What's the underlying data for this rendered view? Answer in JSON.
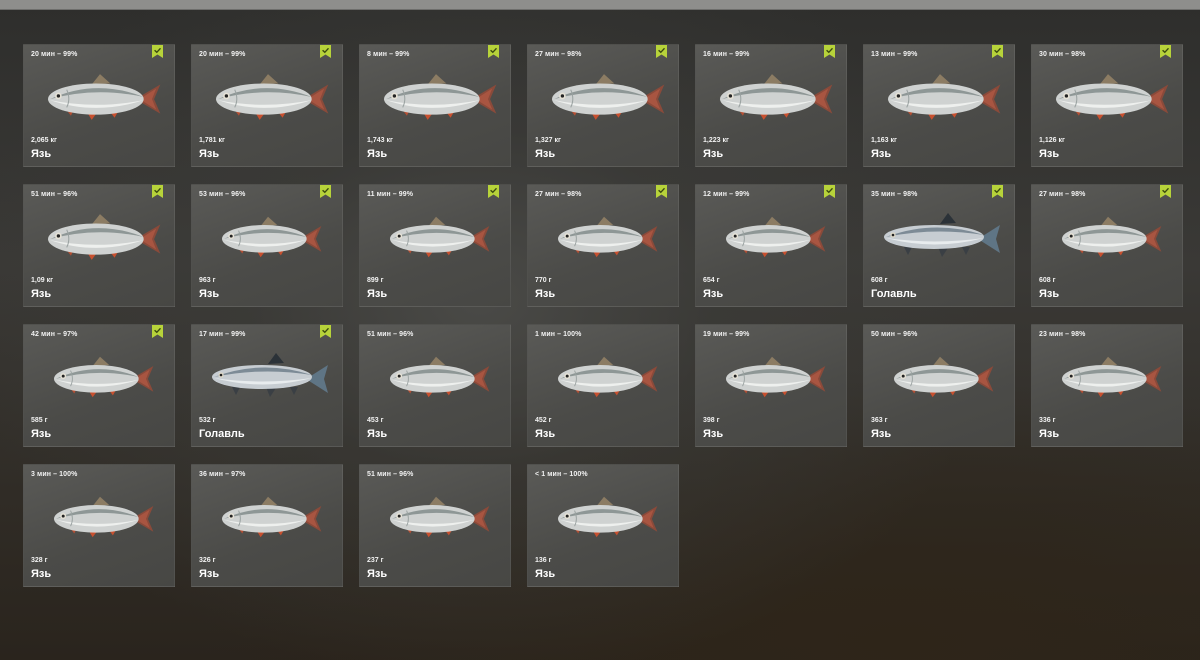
{
  "catches": [
    {
      "meta": "20 мин – 99%",
      "weight": "2,065 кг",
      "species": "Язь",
      "kept": true,
      "fish_icon": "ide-icon"
    },
    {
      "meta": "20 мин – 99%",
      "weight": "1,781 кг",
      "species": "Язь",
      "kept": true,
      "fish_icon": "ide-icon"
    },
    {
      "meta": "8 мин – 99%",
      "weight": "1,743 кг",
      "species": "Язь",
      "kept": true,
      "fish_icon": "ide-icon"
    },
    {
      "meta": "27 мин – 98%",
      "weight": "1,327 кг",
      "species": "Язь",
      "kept": true,
      "fish_icon": "ide-icon"
    },
    {
      "meta": "16 мин – 99%",
      "weight": "1,223 кг",
      "species": "Язь",
      "kept": true,
      "fish_icon": "ide-icon"
    },
    {
      "meta": "13 мин – 99%",
      "weight": "1,163 кг",
      "species": "Язь",
      "kept": true,
      "fish_icon": "ide-icon"
    },
    {
      "meta": "30 мин – 98%",
      "weight": "1,126 кг",
      "species": "Язь",
      "kept": true,
      "fish_icon": "ide-icon"
    },
    {
      "meta": "51 мин – 96%",
      "weight": "1,09 кг",
      "species": "Язь",
      "kept": true,
      "fish_icon": "ide-icon"
    },
    {
      "meta": "53 мин – 96%",
      "weight": "963 г",
      "species": "Язь",
      "kept": true,
      "fish_icon": "ide-icon"
    },
    {
      "meta": "11 мин – 99%",
      "weight": "899 г",
      "species": "Язь",
      "kept": true,
      "fish_icon": "ide-icon"
    },
    {
      "meta": "27 мин – 98%",
      "weight": "770 г",
      "species": "Язь",
      "kept": true,
      "fish_icon": "ide-icon"
    },
    {
      "meta": "12 мин – 99%",
      "weight": "654 г",
      "species": "Язь",
      "kept": true,
      "fish_icon": "ide-icon"
    },
    {
      "meta": "35 мин – 98%",
      "weight": "608 г",
      "species": "Голавль",
      "kept": true,
      "fish_icon": "chub-icon"
    },
    {
      "meta": "27 мин – 98%",
      "weight": "608 г",
      "species": "Язь",
      "kept": true,
      "fish_icon": "ide-icon"
    },
    {
      "meta": "42 мин – 97%",
      "weight": "585 г",
      "species": "Язь",
      "kept": true,
      "fish_icon": "ide-icon"
    },
    {
      "meta": "17 мин – 99%",
      "weight": "532 г",
      "species": "Голавль",
      "kept": true,
      "fish_icon": "chub-icon"
    },
    {
      "meta": "51 мин – 96%",
      "weight": "453 г",
      "species": "Язь",
      "kept": false,
      "fish_icon": "ide-icon"
    },
    {
      "meta": "1 мин – 100%",
      "weight": "452 г",
      "species": "Язь",
      "kept": false,
      "fish_icon": "ide-icon"
    },
    {
      "meta": "19 мин – 99%",
      "weight": "398 г",
      "species": "Язь",
      "kept": false,
      "fish_icon": "ide-icon"
    },
    {
      "meta": "50 мин – 96%",
      "weight": "363 г",
      "species": "Язь",
      "kept": false,
      "fish_icon": "ide-icon"
    },
    {
      "meta": "23 мин – 98%",
      "weight": "336 г",
      "species": "Язь",
      "kept": false,
      "fish_icon": "ide-icon"
    },
    {
      "meta": "3 мин – 100%",
      "weight": "328 г",
      "species": "Язь",
      "kept": false,
      "fish_icon": "ide-icon"
    },
    {
      "meta": "36 мин – 97%",
      "weight": "326 г",
      "species": "Язь",
      "kept": false,
      "fish_icon": "ide-icon"
    },
    {
      "meta": "51 мин – 96%",
      "weight": "237 г",
      "species": "Язь",
      "kept": false,
      "fish_icon": "ide-icon"
    },
    {
      "meta": "< 1 мин – 100%",
      "weight": "136 г",
      "species": "Язь",
      "kept": false,
      "fish_icon": "ide-icon"
    }
  ],
  "colors": {
    "badge": "#b7d33a",
    "card": "#52524f",
    "text": "#f2f2f2"
  }
}
